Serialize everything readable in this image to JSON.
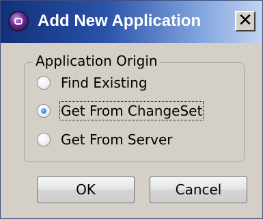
{
  "window": {
    "title": "Add New Application",
    "close_glyph": "×",
    "icon": "app-logo-icon"
  },
  "group": {
    "label": "Application Origin",
    "options": [
      {
        "label": "Find Existing",
        "selected": false
      },
      {
        "label": "Get From ChangeSet",
        "selected": true
      },
      {
        "label": "Get From Server",
        "selected": false
      }
    ]
  },
  "buttons": {
    "ok_label": "OK",
    "cancel_label": "Cancel"
  }
}
